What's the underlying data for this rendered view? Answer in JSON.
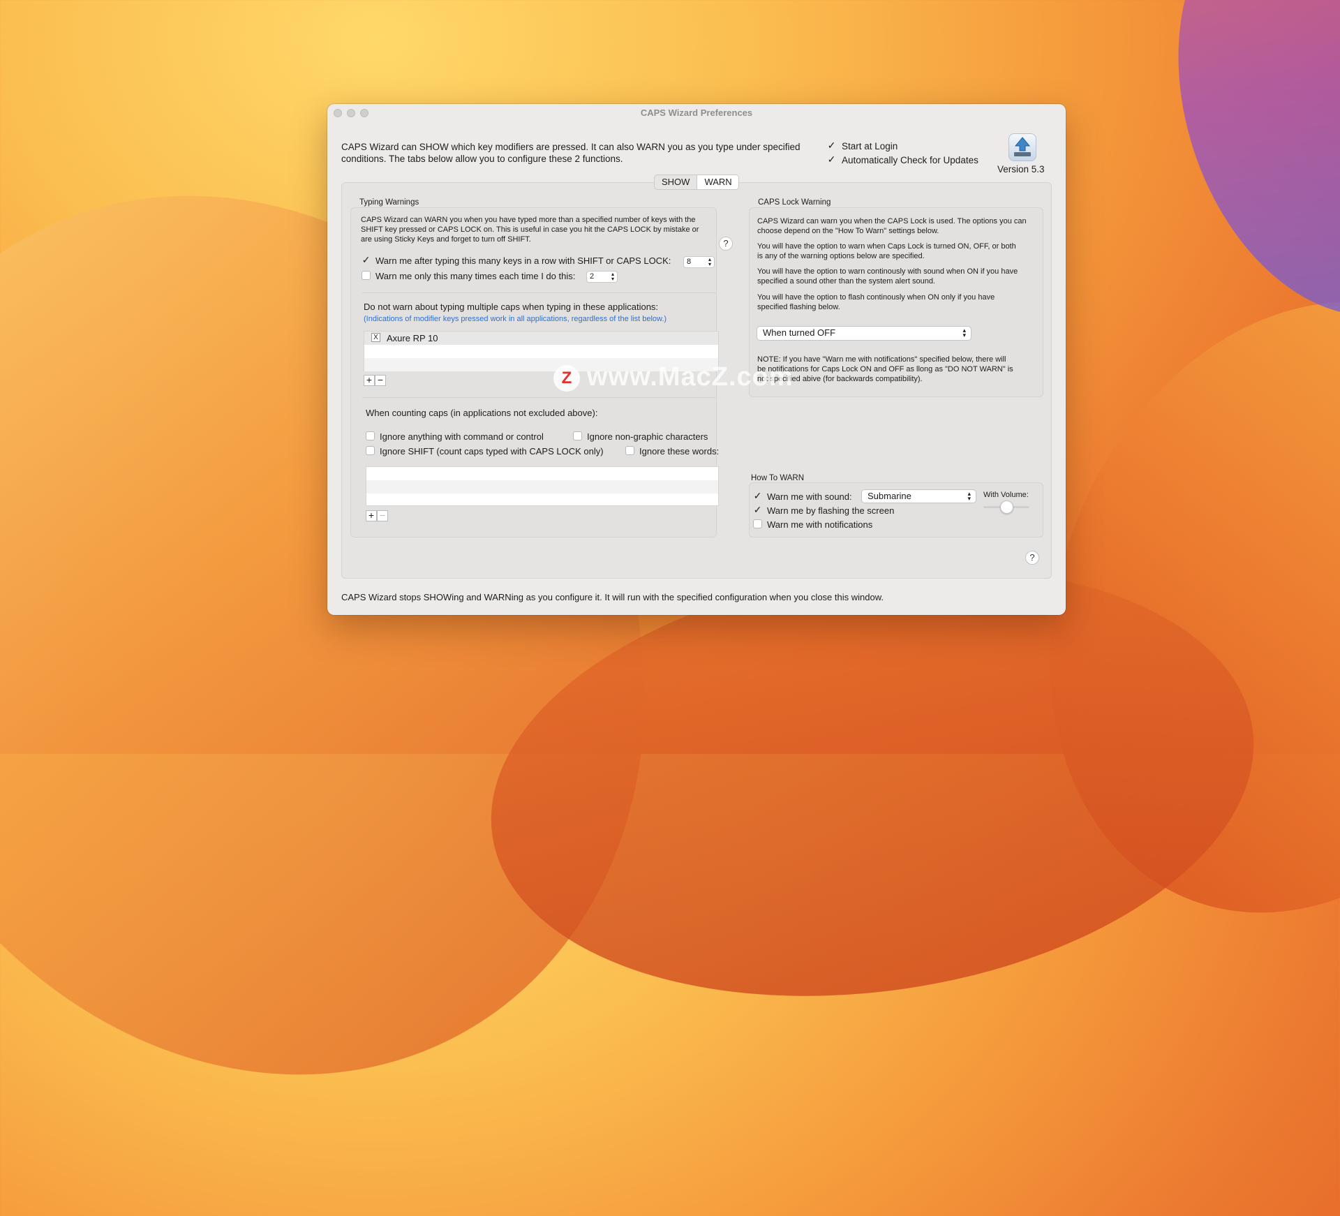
{
  "window": {
    "title": "CAPS Wizard Preferences"
  },
  "intro": {
    "line1": "CAPS Wizard can SHOW which key modifiers are pressed.  It can also WARN you as you type under specified",
    "line2": "conditions.  The tabs below allow you to configure these 2 functions."
  },
  "options": {
    "start_at_login": "Start at Login",
    "auto_check_updates": "Automatically Check for Updates"
  },
  "app": {
    "version": "Version 5.3",
    "icon": "upload-arrow-keyboard-icon"
  },
  "tabs": [
    {
      "label": "SHOW"
    },
    {
      "label": "WARN"
    }
  ],
  "typing_warnings": {
    "heading": "Typing Warnings",
    "desc1": "CAPS Wizard can WARN you when you have typed more than a specified number of keys with the",
    "desc2": "SHIFT key pressed or CAPS LOCK on.  This is useful in case you hit the CAPS LOCK by mistake or",
    "desc3": "are using Sticky Keys and forget to turn off SHIFT.",
    "warn_after_label": "Warn me after typing this many keys in a row with SHIFT or CAPS LOCK:",
    "warn_after_value": "8",
    "warn_only_label": "Warn me only this many times each time I do this:",
    "warn_only_value": "2",
    "exclude_heading": "Do not warn about typing multiple caps when typing in these applications:",
    "exclude_note": "(Indications of modifier keys pressed work in all applications, regardless of the list below.)",
    "excluded_apps": [
      {
        "name": "Axure RP 10",
        "icon": "X"
      }
    ],
    "counting_heading": "When counting caps (in applications not excluded above):",
    "ignore_command": "Ignore anything with command or control",
    "ignore_nongraphic": "Ignore non-graphic characters",
    "ignore_shift": "Ignore SHIFT (count caps typed with CAPS LOCK only)",
    "ignore_words": "Ignore these words:"
  },
  "caps_lock_warning": {
    "heading": "CAPS Lock Warning",
    "p1a": "CAPS Wizard can warn you when the CAPS Lock is used. The options you can",
    "p1b": "choose depend on the \"How To Warn\" settings below.",
    "p2a": "You will have the option to warn when Caps Lock is turned ON, OFF, or both",
    "p2b": "is any of the warning options below are specified.",
    "p3a": "You will have the option to warn continously with sound when ON if you have",
    "p3b": "specified a sound other than the system alert sound.",
    "p4a": "You will have the option to flash continously when ON only if you have",
    "p4b": "specified flashing below.",
    "mode": "When turned OFF",
    "note1": "NOTE: If you have \"Warn me with notifications\" specified below, there will",
    "note2": "be notifications for Caps Lock ON and OFF as llong as \"DO NOT WARN\" is",
    "note3": "not specified abive (for backwards compatibility)."
  },
  "how_to_warn": {
    "heading": "How To WARN",
    "sound_label": "Warn me with sound:",
    "sound_value": "Submarine",
    "volume_label": "With Volume:",
    "volume": 0.5,
    "flash_label": "Warn me by flashing the screen",
    "notify_label": "Warn me with notifications"
  },
  "footer": "CAPS Wizard stops SHOWing and WARNing as you configure it.  It will run with the specified configuration when you close this window.",
  "watermark": {
    "text": "www.MacZ.com",
    "logo": "Z"
  },
  "colors": {
    "accent_link": "#2f6fd0",
    "window_bg": "#ecebea"
  }
}
